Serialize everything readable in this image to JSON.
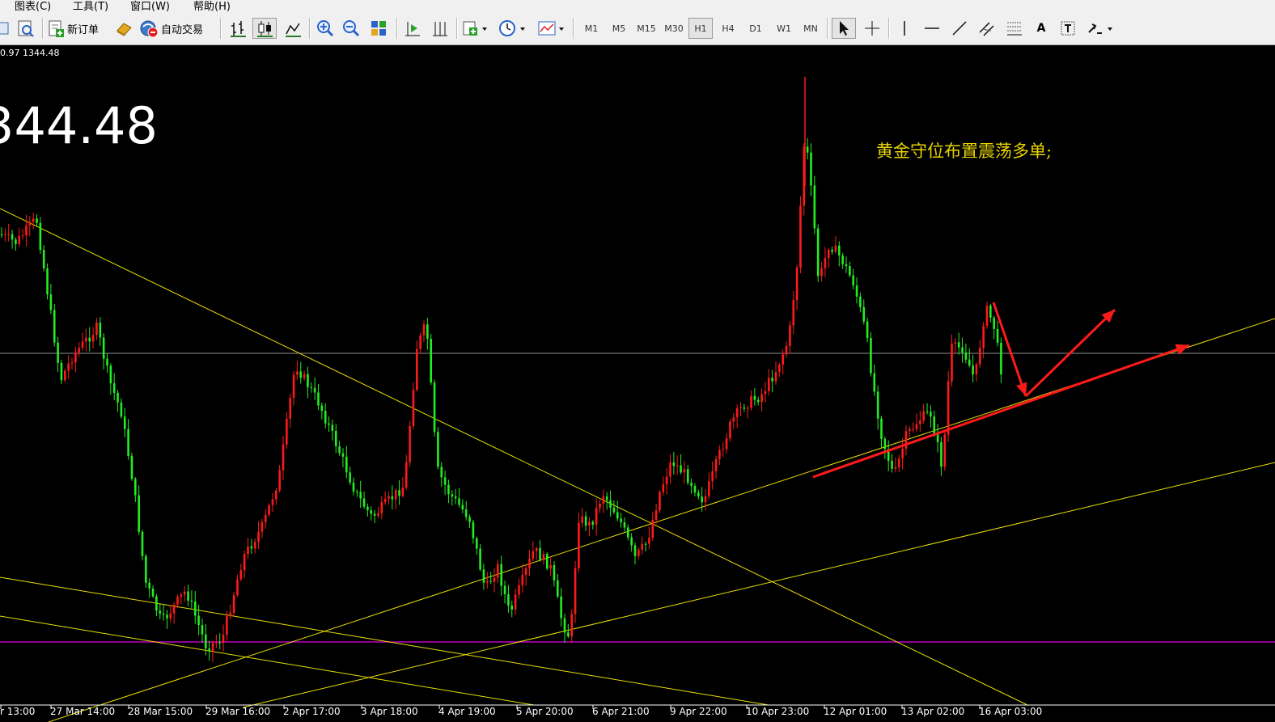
{
  "menu": [
    "图表(C)",
    "工具(T)",
    "窗口(W)",
    "帮助(H)"
  ],
  "toolbar": {
    "new_order_label": "新订单",
    "auto_trade_label": "自动交易",
    "timeframes": [
      "M1",
      "M5",
      "M15",
      "M30",
      "H1",
      "H4",
      "D1",
      "W1",
      "MN"
    ],
    "active_timeframe": "H1",
    "text_tool_label": "A"
  },
  "chart": {
    "ohlc_readout": "0.97 1344.48",
    "current_price": "344.48",
    "annotation": "黄金守位布置震荡多单;",
    "colors": {
      "background": "#000000",
      "bull": "#ff1a1a",
      "bear": "#22ee22",
      "trendline": "#e8e000",
      "support": "#c000c0",
      "price_line": "#8f8f8f",
      "arrow": "#ff1a1a"
    }
  },
  "chart_data": {
    "type": "candlestick",
    "x_ticks": [
      "r 13:00",
      "27 Mar 14:00",
      "28 Mar 15:00",
      "29 Mar 16:00",
      "2 Apr 17:00",
      "3 Apr 18:00",
      "4 Apr 19:00",
      "5 Apr 20:00",
      "6 Apr 21:00",
      "9 Apr 22:00",
      "10 Apr 23:00",
      "12 Apr 01:00",
      "13 Apr 02:00",
      "16 Apr 03:00"
    ],
    "last_price": 1344.48,
    "price_readout": [
      "0.97",
      "1344.48"
    ]
  }
}
